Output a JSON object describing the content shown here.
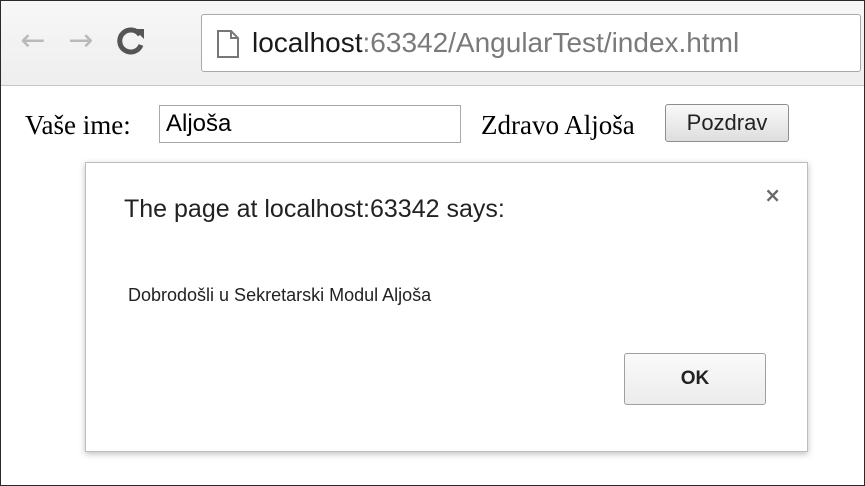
{
  "browser": {
    "back_icon": "arrow-left-icon",
    "forward_icon": "arrow-right-icon",
    "reload_icon": "reload-icon",
    "page_icon": "document-icon",
    "url_host": "localhost",
    "url_rest": ":63342/AngularTest/index.html"
  },
  "page": {
    "name_label": "Vaše ime:",
    "name_value": "Aljoša",
    "greeting": "Zdravo Aljoša",
    "greet_button_label": "Pozdrav"
  },
  "dialog": {
    "title": "The page at localhost:63342 says:",
    "message": "Dobrodošli u Sekretarski Modul Aljoša",
    "close_glyph": "×",
    "ok_label": "OK"
  }
}
